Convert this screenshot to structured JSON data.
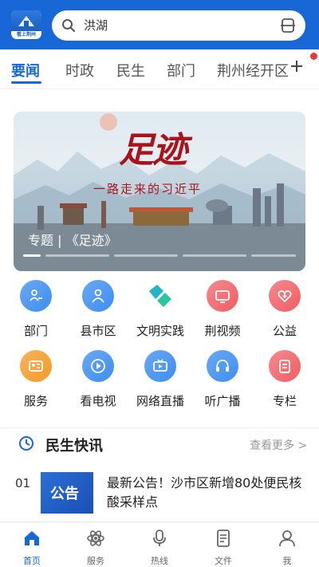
{
  "header": {
    "logo_text": "看上荆州",
    "search_text": "洪湖"
  },
  "tabs": [
    {
      "label": "要闻",
      "active": true
    },
    {
      "label": "时政"
    },
    {
      "label": "民生"
    },
    {
      "label": "部门"
    },
    {
      "label": "荆州经开区"
    }
  ],
  "banner": {
    "calligraphy": "足迹",
    "subtitle": "一路走来的习近平",
    "caption": "专题 | 《足迹》"
  },
  "grid": [
    {
      "label": "部门",
      "icon": "department-icon",
      "color": "#3d8ef0"
    },
    {
      "label": "县市区",
      "icon": "person-icon",
      "color": "#3d8ef0"
    },
    {
      "label": "文明实践",
      "icon": "heart-hands-icon",
      "color": "#1fb4c6"
    },
    {
      "label": "荆视频",
      "icon": "tv-icon",
      "color": "#ef5d63"
    },
    {
      "label": "公益",
      "icon": "charity-heart-icon",
      "color": "#ef5d63"
    },
    {
      "label": "服务",
      "icon": "id-card-icon",
      "color": "#f39a2b"
    },
    {
      "label": "看电视",
      "icon": "play-icon",
      "color": "#3d8ef0"
    },
    {
      "label": "网络直播",
      "icon": "live-video-icon",
      "color": "#3d8ef0"
    },
    {
      "label": "听广播",
      "icon": "headphones-icon",
      "color": "#3d8ef0"
    },
    {
      "label": "专栏",
      "icon": "column-doc-icon",
      "color": "#ef5d63"
    }
  ],
  "news_section": {
    "title": "民生快讯",
    "more": "查看更多 >"
  },
  "news": [
    {
      "num": "01",
      "thumb_text": "公告",
      "headline": "最新公告！沙市区新增80处便民核酸采样点"
    }
  ],
  "bottom_nav": [
    {
      "label": "首页",
      "active": true
    },
    {
      "label": "服务"
    },
    {
      "label": "热线"
    },
    {
      "label": "文件"
    },
    {
      "label": "我"
    }
  ],
  "colors": {
    "brand": "#1768d6",
    "alert": "#e43a3a"
  }
}
